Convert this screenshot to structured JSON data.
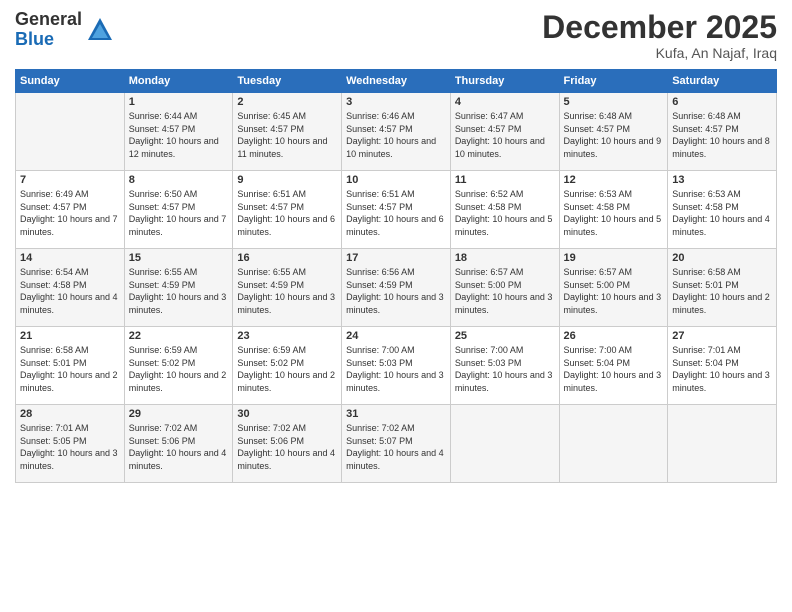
{
  "logo": {
    "general": "General",
    "blue": "Blue"
  },
  "title": "December 2025",
  "location": "Kufa, An Najaf, Iraq",
  "headers": [
    "Sunday",
    "Monday",
    "Tuesday",
    "Wednesday",
    "Thursday",
    "Friday",
    "Saturday"
  ],
  "weeks": [
    [
      {
        "day": "",
        "sunrise": "",
        "sunset": "",
        "daylight": ""
      },
      {
        "day": "1",
        "sunrise": "Sunrise: 6:44 AM",
        "sunset": "Sunset: 4:57 PM",
        "daylight": "Daylight: 10 hours and 12 minutes."
      },
      {
        "day": "2",
        "sunrise": "Sunrise: 6:45 AM",
        "sunset": "Sunset: 4:57 PM",
        "daylight": "Daylight: 10 hours and 11 minutes."
      },
      {
        "day": "3",
        "sunrise": "Sunrise: 6:46 AM",
        "sunset": "Sunset: 4:57 PM",
        "daylight": "Daylight: 10 hours and 10 minutes."
      },
      {
        "day": "4",
        "sunrise": "Sunrise: 6:47 AM",
        "sunset": "Sunset: 4:57 PM",
        "daylight": "Daylight: 10 hours and 10 minutes."
      },
      {
        "day": "5",
        "sunrise": "Sunrise: 6:48 AM",
        "sunset": "Sunset: 4:57 PM",
        "daylight": "Daylight: 10 hours and 9 minutes."
      },
      {
        "day": "6",
        "sunrise": "Sunrise: 6:48 AM",
        "sunset": "Sunset: 4:57 PM",
        "daylight": "Daylight: 10 hours and 8 minutes."
      }
    ],
    [
      {
        "day": "7",
        "sunrise": "Sunrise: 6:49 AM",
        "sunset": "Sunset: 4:57 PM",
        "daylight": "Daylight: 10 hours and 7 minutes."
      },
      {
        "day": "8",
        "sunrise": "Sunrise: 6:50 AM",
        "sunset": "Sunset: 4:57 PM",
        "daylight": "Daylight: 10 hours and 7 minutes."
      },
      {
        "day": "9",
        "sunrise": "Sunrise: 6:51 AM",
        "sunset": "Sunset: 4:57 PM",
        "daylight": "Daylight: 10 hours and 6 minutes."
      },
      {
        "day": "10",
        "sunrise": "Sunrise: 6:51 AM",
        "sunset": "Sunset: 4:57 PM",
        "daylight": "Daylight: 10 hours and 6 minutes."
      },
      {
        "day": "11",
        "sunrise": "Sunrise: 6:52 AM",
        "sunset": "Sunset: 4:58 PM",
        "daylight": "Daylight: 10 hours and 5 minutes."
      },
      {
        "day": "12",
        "sunrise": "Sunrise: 6:53 AM",
        "sunset": "Sunset: 4:58 PM",
        "daylight": "Daylight: 10 hours and 5 minutes."
      },
      {
        "day": "13",
        "sunrise": "Sunrise: 6:53 AM",
        "sunset": "Sunset: 4:58 PM",
        "daylight": "Daylight: 10 hours and 4 minutes."
      }
    ],
    [
      {
        "day": "14",
        "sunrise": "Sunrise: 6:54 AM",
        "sunset": "Sunset: 4:58 PM",
        "daylight": "Daylight: 10 hours and 4 minutes."
      },
      {
        "day": "15",
        "sunrise": "Sunrise: 6:55 AM",
        "sunset": "Sunset: 4:59 PM",
        "daylight": "Daylight: 10 hours and 3 minutes."
      },
      {
        "day": "16",
        "sunrise": "Sunrise: 6:55 AM",
        "sunset": "Sunset: 4:59 PM",
        "daylight": "Daylight: 10 hours and 3 minutes."
      },
      {
        "day": "17",
        "sunrise": "Sunrise: 6:56 AM",
        "sunset": "Sunset: 4:59 PM",
        "daylight": "Daylight: 10 hours and 3 minutes."
      },
      {
        "day": "18",
        "sunrise": "Sunrise: 6:57 AM",
        "sunset": "Sunset: 5:00 PM",
        "daylight": "Daylight: 10 hours and 3 minutes."
      },
      {
        "day": "19",
        "sunrise": "Sunrise: 6:57 AM",
        "sunset": "Sunset: 5:00 PM",
        "daylight": "Daylight: 10 hours and 3 minutes."
      },
      {
        "day": "20",
        "sunrise": "Sunrise: 6:58 AM",
        "sunset": "Sunset: 5:01 PM",
        "daylight": "Daylight: 10 hours and 2 minutes."
      }
    ],
    [
      {
        "day": "21",
        "sunrise": "Sunrise: 6:58 AM",
        "sunset": "Sunset: 5:01 PM",
        "daylight": "Daylight: 10 hours and 2 minutes."
      },
      {
        "day": "22",
        "sunrise": "Sunrise: 6:59 AM",
        "sunset": "Sunset: 5:02 PM",
        "daylight": "Daylight: 10 hours and 2 minutes."
      },
      {
        "day": "23",
        "sunrise": "Sunrise: 6:59 AM",
        "sunset": "Sunset: 5:02 PM",
        "daylight": "Daylight: 10 hours and 2 minutes."
      },
      {
        "day": "24",
        "sunrise": "Sunrise: 7:00 AM",
        "sunset": "Sunset: 5:03 PM",
        "daylight": "Daylight: 10 hours and 3 minutes."
      },
      {
        "day": "25",
        "sunrise": "Sunrise: 7:00 AM",
        "sunset": "Sunset: 5:03 PM",
        "daylight": "Daylight: 10 hours and 3 minutes."
      },
      {
        "day": "26",
        "sunrise": "Sunrise: 7:00 AM",
        "sunset": "Sunset: 5:04 PM",
        "daylight": "Daylight: 10 hours and 3 minutes."
      },
      {
        "day": "27",
        "sunrise": "Sunrise: 7:01 AM",
        "sunset": "Sunset: 5:04 PM",
        "daylight": "Daylight: 10 hours and 3 minutes."
      }
    ],
    [
      {
        "day": "28",
        "sunrise": "Sunrise: 7:01 AM",
        "sunset": "Sunset: 5:05 PM",
        "daylight": "Daylight: 10 hours and 3 minutes."
      },
      {
        "day": "29",
        "sunrise": "Sunrise: 7:02 AM",
        "sunset": "Sunset: 5:06 PM",
        "daylight": "Daylight: 10 hours and 4 minutes."
      },
      {
        "day": "30",
        "sunrise": "Sunrise: 7:02 AM",
        "sunset": "Sunset: 5:06 PM",
        "daylight": "Daylight: 10 hours and 4 minutes."
      },
      {
        "day": "31",
        "sunrise": "Sunrise: 7:02 AM",
        "sunset": "Sunset: 5:07 PM",
        "daylight": "Daylight: 10 hours and 4 minutes."
      },
      {
        "day": "",
        "sunrise": "",
        "sunset": "",
        "daylight": ""
      },
      {
        "day": "",
        "sunrise": "",
        "sunset": "",
        "daylight": ""
      },
      {
        "day": "",
        "sunrise": "",
        "sunset": "",
        "daylight": ""
      }
    ]
  ]
}
